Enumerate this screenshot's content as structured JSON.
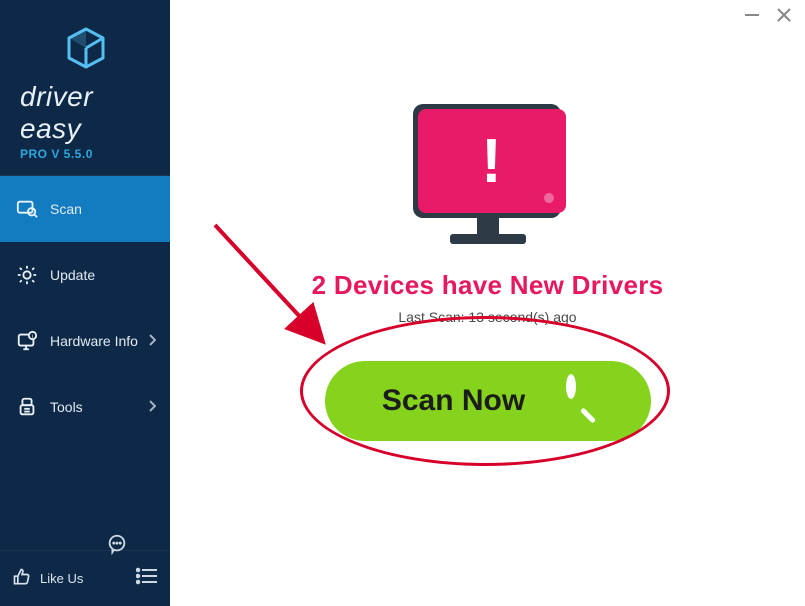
{
  "app": {
    "name": "driver easy",
    "version_label": "PRO V 5.5.0"
  },
  "sidebar": {
    "items": [
      {
        "label": "Scan",
        "icon": "scan-icon",
        "selected": true,
        "has_chevron": false
      },
      {
        "label": "Update",
        "icon": "gear-refresh-icon",
        "selected": false,
        "has_chevron": false
      },
      {
        "label": "Hardware Info",
        "icon": "hardware-icon",
        "selected": false,
        "has_chevron": true
      },
      {
        "label": "Tools",
        "icon": "tools-icon",
        "selected": false,
        "has_chevron": true
      }
    ],
    "like_us_label": "Like Us"
  },
  "main": {
    "headline": "2 Devices have New Drivers",
    "last_scan": "Last Scan: 13 second(s) ago",
    "scan_button_label": "Scan Now"
  },
  "colors": {
    "accent_pink": "#e91a67",
    "accent_green": "#85d31d",
    "sidebar_bg": "#0e2947",
    "sidebar_selected": "#137cc1",
    "annotation_red": "#d6002a"
  }
}
